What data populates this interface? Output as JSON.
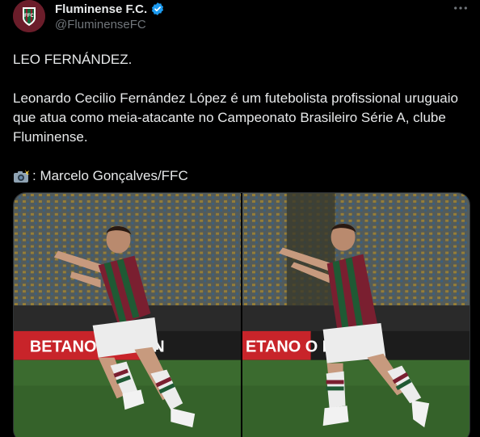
{
  "author": {
    "name": "Fluminense F.C.",
    "handle": "@FluminenseFC",
    "verified": true,
    "avatar_icon": "fluminense-crest-icon",
    "brand_color": "#6b1d2a"
  },
  "more_icon": "more-options-icon",
  "tweet": {
    "headline": "LEO FERNÁNDEZ.",
    "description": "Leonardo Cecilio Fernández López é um futebolista profissional uruguaio que atua como meia-atacante no Campeonato Brasileiro Série A, clube Fluminense.",
    "credit_icon": "camera-flash-icon",
    "credit": ": Marcelo Gonçalves/FFC"
  },
  "media": {
    "photos": [
      {
        "icon": "player-celebration-photo-left",
        "board_text": "BETANO  VO BÔN"
      },
      {
        "icon": "player-celebration-photo-right",
        "board_text": "ETANO   O BÔNUS"
      }
    ]
  },
  "colors": {
    "background": "#000000",
    "text": "#e7e9ea",
    "secondary_text": "#71767b",
    "verified_blue": "#1d9bf0",
    "pitch_green": "#3b6b2f",
    "ad_board_red": "#c8242a"
  }
}
